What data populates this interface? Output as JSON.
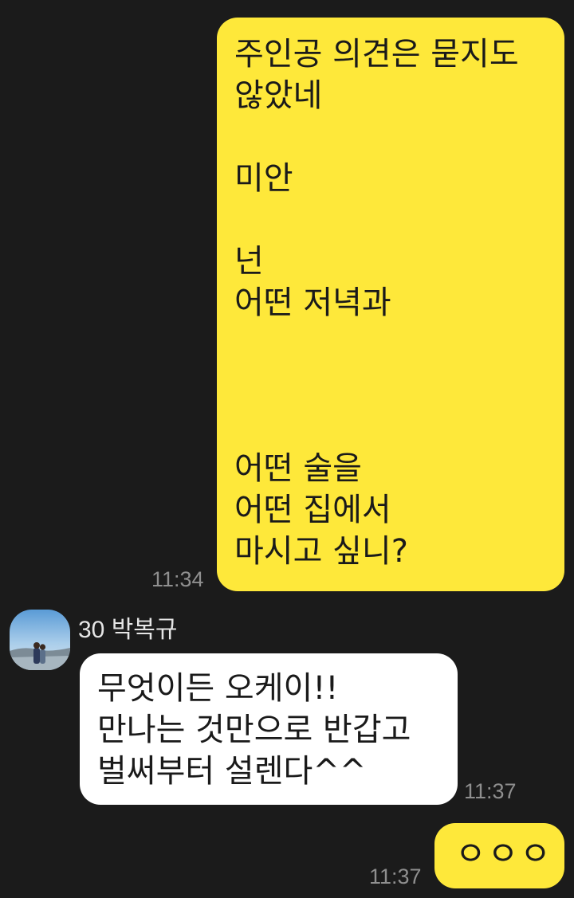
{
  "conversation": {
    "messages": [
      {
        "id": "msg1",
        "from": "me",
        "text": "주인공 의견은 묻지도\n않았네\n\n미안\n\n넌\n어떤 저녁과\n\n\n\n어떤 술을\n어떤 집에서\n마시고 싶니?",
        "time": "11:34"
      },
      {
        "id": "msg2",
        "from": "other",
        "sender": "30 박복규",
        "text": "무엇이든 오케이!!\n만나는 것만으로 반갑고\n벌써부터 설렌다^^",
        "time": "11:37"
      },
      {
        "id": "msg3",
        "from": "me",
        "text": "ㅇㅇㅇ",
        "time": "11:37"
      }
    ]
  },
  "colors": {
    "background": "#1b1b1b",
    "my_bubble": "#fee83a",
    "their_bubble": "#ffffff",
    "timestamp": "#8f8f8f"
  },
  "icons": {
    "avatar": "profile-photo-avatar"
  }
}
